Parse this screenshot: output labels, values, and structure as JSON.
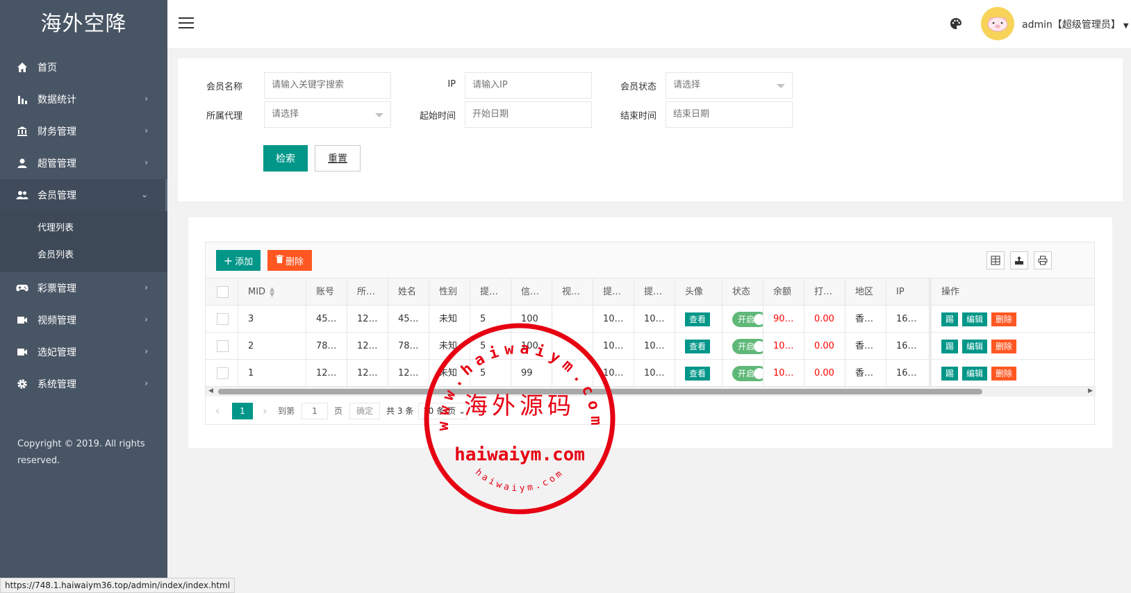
{
  "app": {
    "logo": "海外空降"
  },
  "sidebar": {
    "items": [
      {
        "label": "首页",
        "icon": "home-icon"
      },
      {
        "label": "数据统计",
        "icon": "bar-chart-icon"
      },
      {
        "label": "财务管理",
        "icon": "bank-icon"
      },
      {
        "label": "超管管理",
        "icon": "user-icon"
      },
      {
        "label": "会员管理",
        "icon": "users-icon"
      },
      {
        "label": "彩票管理",
        "icon": "gamepad-icon"
      },
      {
        "label": "视频管理",
        "icon": "video-camera-icon"
      },
      {
        "label": "选妃管理",
        "icon": "video-camera-icon"
      },
      {
        "label": "系统管理",
        "icon": "gear-icon"
      }
    ],
    "submenu": [
      "代理列表",
      "会员列表"
    ],
    "copyright": "Copyright © 2019. All rights reserved."
  },
  "header": {
    "user": "admin【超级管理员】"
  },
  "search": {
    "member_name_label": "会员名称",
    "member_name_placeholder": "请输入关键字搜索",
    "ip_label": "IP",
    "ip_placeholder": "请输入IP",
    "status_label": "会员状态",
    "status_value": "请选择",
    "agent_label": "所属代理",
    "agent_value": "请选择",
    "start_label": "起始时间",
    "start_placeholder": "开始日期",
    "end_label": "结束时间",
    "end_placeholder": "结束日期",
    "search_button": "检索",
    "reset_button": "重置"
  },
  "toolbar": {
    "add": "添加",
    "delete": "删除"
  },
  "table": {
    "headers": [
      "MID",
      "账号",
      "所…",
      "姓名",
      "性别",
      "提…",
      "信…",
      "视…",
      "提…",
      "提…",
      "头像",
      "状态",
      "余额",
      "打…",
      "地区",
      "IP",
      "操作"
    ],
    "rows": [
      {
        "mid": "3",
        "account": "45…",
        "agent": "12…",
        "name": "45…",
        "gender": "未知",
        "c1": "5",
        "credit": "100",
        "video": "",
        "c2": "10…",
        "c3": "10…",
        "avatar_btn": "查看",
        "status": "开启",
        "balance": "90…",
        "bet": "0.00",
        "region": "香…",
        "ip": "16…"
      },
      {
        "mid": "2",
        "account": "78…",
        "agent": "12…",
        "name": "78…",
        "gender": "未知",
        "c1": "5",
        "credit": "100",
        "video": "",
        "c2": "10…",
        "c3": "10…",
        "avatar_btn": "查看",
        "status": "开启",
        "balance": "10…",
        "bet": "0.00",
        "region": "香…",
        "ip": "16…"
      },
      {
        "mid": "1",
        "account": "12…",
        "agent": "12…",
        "name": "12…",
        "gender": "未知",
        "c1": "5",
        "credit": "99",
        "video": "",
        "c2": "10…",
        "c3": "10…",
        "avatar_btn": "查看",
        "status": "开启",
        "balance": "10…",
        "bet": "0.00",
        "region": "香…",
        "ip": "16…"
      }
    ],
    "actions": {
      "kick": "踢",
      "edit": "编辑",
      "delete": "删除"
    }
  },
  "pager": {
    "current": "1",
    "goto_label": "到第",
    "page_input": "1",
    "page_suffix": "页",
    "confirm": "确定",
    "total": "共 3 条",
    "per_page": "10 条/页"
  },
  "status_bar": {
    "url": "https://748.1.haiwaiym36.top/admin/index/index.html"
  },
  "watermark": {
    "top_arc": "www.haiwaiym.com",
    "center": "海外源码",
    "lower": "haiwaiym.com",
    "bottom_arc": "haiwaiym.com"
  },
  "colors": {
    "sidebar": "#485565",
    "primary": "#009688",
    "danger": "#ff5722",
    "switch": "#5fb878",
    "stamp": "#e60012"
  }
}
